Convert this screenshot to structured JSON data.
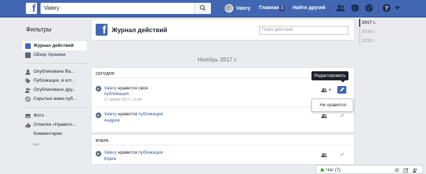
{
  "topbar": {
    "logo_letter": "f",
    "search_value": "Valery",
    "user_name": "Valery",
    "home_label": "Главная",
    "home_badge": "3",
    "find_friends_label": "Найти друзей",
    "icons": [
      "search-icon",
      "friends-icon",
      "messenger-icon",
      "notifications-icon",
      "help-icon",
      "chevron-down-icon"
    ]
  },
  "sidebar": {
    "title": "Фильтры",
    "items": [
      {
        "label": "Журнал действий",
        "active": true
      },
      {
        "label": "Обзор Хроники"
      },
      {
        "label": "Опубликовано Ва..."
      },
      {
        "label": "Публикации, в кот..."
      },
      {
        "label": "Опубликовано дру..."
      },
      {
        "label": "Скрытые вами пуб..."
      },
      {
        "label": "Фото"
      },
      {
        "label": "Отметки «Нравитс..."
      },
      {
        "label": "Комментарии"
      }
    ],
    "more_label": "еще"
  },
  "header": {
    "logo_letter": "f",
    "title": "Журнал действий",
    "search_placeholder": "Поиск действий"
  },
  "month_label": "Ноябрь 2017 г.",
  "sections": [
    {
      "label": "СЕГОДНЯ",
      "rows": [
        {
          "actor": "Valery",
          "verb": "нравится своя",
          "object": "публикация.",
          "time": "17 ноября 2017 г. 16:44"
        },
        {
          "actor": "Valery",
          "verb": "нравится",
          "object": "публикация",
          "subject": "Андрея"
        }
      ]
    },
    {
      "label": "ВЧЕРА",
      "rows": [
        {
          "actor": "Valery",
          "verb": "нравится",
          "object": "публикация",
          "subject": "Юрия"
        }
      ]
    }
  ],
  "tooltip": "Редактировать",
  "dropdown_item": "Не нравится",
  "years": [
    "2017 г.",
    "2016 г.",
    "2015 г."
  ],
  "chat": {
    "label": "Чат (7)"
  },
  "colors": {
    "brand": "#4267b2",
    "background": "#e9ebee",
    "link": "#365899",
    "online": "#42b72a"
  }
}
